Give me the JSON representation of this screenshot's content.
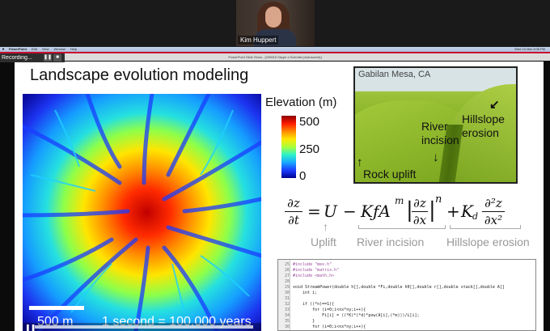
{
  "zoom": {
    "participant_name": "Kim Huppert"
  },
  "menubar": {
    "app": "PowerPoint",
    "items": [
      "Edit",
      "View",
      "Window",
      "Help"
    ],
    "right": [
      "Wed 15 Mar 3:08 PM"
    ]
  },
  "recording": {
    "label": "Recording...",
    "pause_icon": "pause-icon",
    "stop_icon": "stop-icon"
  },
  "window": {
    "title": "PowerPoint Slide Show - [200616 Skype a Scientist (Autosaved)]"
  },
  "slide": {
    "title": "Landscape evolution modeling",
    "map": {
      "scale_label": "500 m",
      "time_label": "1 second = 100,000 years"
    },
    "legend": {
      "title": "Elevation (m)",
      "ticks": [
        "500",
        "250",
        "0"
      ]
    },
    "photo": {
      "title": "Gabilan Mesa, CA",
      "labels": {
        "river": "River incision",
        "hillslope": "Hillslope erosion",
        "uplift": "Rock uplift"
      }
    },
    "equation": {
      "lhs_num": "∂z",
      "lhs_den": "∂t",
      "equals": "=",
      "uplift": "U",
      "minus": "−",
      "erosion_coeff": "KƒA",
      "erosion_exp": "m",
      "grad_num": "∂z",
      "grad_den": "∂x",
      "grad_exp": "n",
      "plus": "+",
      "diff_coeff": "K",
      "diff_sub": "d",
      "diff_num": "∂²z",
      "diff_den": "∂x²",
      "labels": [
        "Uplift",
        "River incision",
        "Hillslope erosion"
      ]
    },
    "code": [
      {
        "n": "25",
        "text": "#include \"mex.h\"",
        "cls": "pp"
      },
      {
        "n": "26",
        "text": "#include \"matrix.h\"",
        "cls": "pp"
      },
      {
        "n": "27",
        "text": "#include <math.h>",
        "cls": "pp"
      },
      {
        "n": "28",
        "text": "",
        "cls": ""
      },
      {
        "n": "29",
        "text": "void StreamPower(double h[],double *Fi,double h0[],double r[],double stack[],double A[]",
        "cls": ""
      },
      {
        "n": "30",
        "text": "    int i;",
        "cls": ""
      },
      {
        "n": "31",
        "text": "",
        "cls": ""
      },
      {
        "n": "32",
        "text": "    if ((*n)==1){",
        "cls": ""
      },
      {
        "n": "33",
        "text": "        for (i=0;i<nx*ny;i++){",
        "cls": ""
      },
      {
        "n": "34",
        "text": "            Fi[i] = ((*K)*(*d)*pow(A[i],(*m)))/L[i];",
        "cls": ""
      },
      {
        "n": "35",
        "text": "        }",
        "cls": ""
      },
      {
        "n": "36",
        "text": "        for (i=0;i<nx*ny;i++){",
        "cls": ""
      }
    ]
  }
}
